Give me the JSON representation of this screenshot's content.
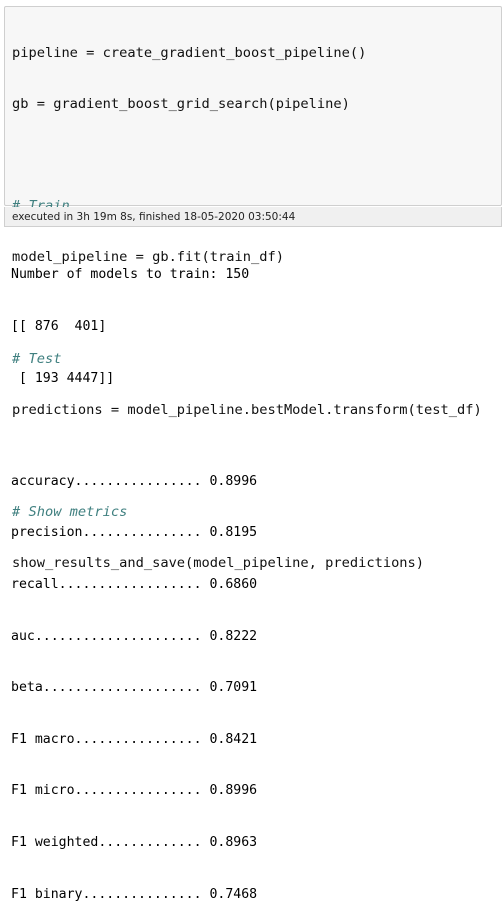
{
  "code_cell": {
    "lines": [
      {
        "text": "pipeline = create_gradient_boost_pipeline()",
        "kind": "code"
      },
      {
        "text": "gb = gradient_boost_grid_search(pipeline)",
        "kind": "code"
      },
      {
        "text": "",
        "kind": "blank"
      },
      {
        "text": "# Train",
        "kind": "comment"
      },
      {
        "text": "model_pipeline = gb.fit(train_df)",
        "kind": "code"
      },
      {
        "text": "",
        "kind": "blank"
      },
      {
        "text": "# Test",
        "kind": "comment"
      },
      {
        "text": "predictions = model_pipeline.bestModel.transform(test_df)",
        "kind": "code"
      },
      {
        "text": "",
        "kind": "blank"
      },
      {
        "text": "# Show metrics",
        "kind": "comment"
      },
      {
        "text": "show_results_and_save(model_pipeline, predictions)",
        "kind": "code"
      }
    ]
  },
  "execution_info": "executed in 3h 19m 8s, finished 18-05-2020 03:50:44",
  "output": {
    "lines": [
      "Number of models to train: 150",
      "[[ 876  401]",
      " [ 193 4447]]",
      "",
      "accuracy................ 0.8996",
      "precision............... 0.8195",
      "recall.................. 0.6860",
      "auc..................... 0.8222",
      "beta.................... 0.7091",
      "F1 macro................ 0.8421",
      "F1 micro................ 0.8996",
      "F1 weighted............. 0.8963",
      "F1 binary............... 0.7468"
    ]
  },
  "colors": {
    "code_background": "#f7f7f7",
    "comment": "#408080",
    "border": "#cfcfcf"
  }
}
